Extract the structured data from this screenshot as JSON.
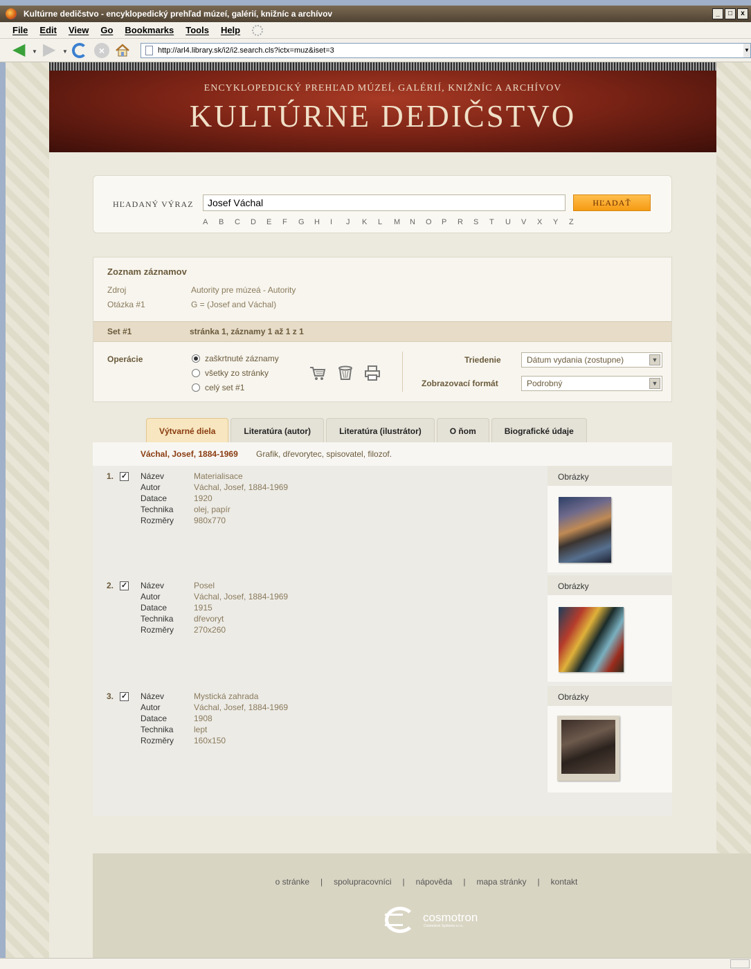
{
  "window": {
    "title": "Kultúrne dedičstvo - encyklopedický prehľad múzeí, galérií, knižníc a archívov",
    "buttons": {
      "minimize": "_",
      "maximize": "□",
      "close": "x"
    }
  },
  "menu": [
    "File",
    "Edit",
    "View",
    "Go",
    "Bookmarks",
    "Tools",
    "Help"
  ],
  "address": {
    "url": "http://arl4.library.sk/i2/i2.search.cls?ictx=muz&iset=3"
  },
  "banner": {
    "subtitle": "ENCYKLOPEDICKÝ PREHĽAD MÚZEÍ, GALÉRIÍ, KNIŽNÍC A ARCHÍVOV",
    "title": "KULTÚRNE DEDIČSTVO"
  },
  "search": {
    "label": "HĽADANÝ VÝRAZ",
    "value": "Josef Váchal",
    "button": "HĽADAŤ",
    "alphabet": [
      "A",
      "B",
      "C",
      "D",
      "E",
      "F",
      "G",
      "H",
      "I",
      "J",
      "K",
      "L",
      "M",
      "N",
      "O",
      "P",
      "R",
      "S",
      "T",
      "U",
      "V",
      "X",
      "Y",
      "Z"
    ]
  },
  "records": {
    "title": "Zoznam záznamov",
    "source_label": "Zdroj",
    "source_value": "Autority pre múzeá - Autority",
    "query_label": "Otázka #1",
    "query_value": "G = (Josef and Váchal)",
    "set_label": "Set #1",
    "set_info": "stránka 1, záznamy 1 až 1 z 1",
    "operations_label": "Operácie",
    "options": [
      "zaškrtnuté záznamy",
      "všetky zo stránky",
      "celý set #1"
    ],
    "selected_option": "zaškrtnuté záznamy",
    "sort_label": "Triedenie",
    "sort_value": "Dátum vydania (zostupne)",
    "format_label": "Zobrazovací formát",
    "format_value": "Podrobný"
  },
  "tabs": [
    {
      "label": "Výtvarné diela",
      "active": true
    },
    {
      "label": "Literatúra (autor)",
      "active": false
    },
    {
      "label": "Literatúra (ilustrátor)",
      "active": false
    },
    {
      "label": "O ňom",
      "active": false
    },
    {
      "label": "Biografické údaje",
      "active": false
    }
  ],
  "author": {
    "name": "Váchal, Josef, 1884-1969",
    "desc": "Grafik, dřevorytec, spisovatel, filozof."
  },
  "field_labels": {
    "nazev": "Název",
    "autor": "Autor",
    "datace": "Datace",
    "technika": "Technika",
    "rozmery": "Rozměry",
    "images": "Obrázky"
  },
  "items": [
    {
      "num": "1.",
      "checked": true,
      "nazev": "Materialisace",
      "autor": "Váchal, Josef, 1884-1969",
      "datace": "1920",
      "technika": "olej, papír",
      "rozmery": "980x770"
    },
    {
      "num": "2.",
      "checked": true,
      "nazev": "Posel",
      "autor": "Váchal, Josef, 1884-1969",
      "datace": "1915",
      "technika": "dřevoryt",
      "rozmery": "270x260"
    },
    {
      "num": "3.",
      "checked": true,
      "nazev": "Mystická zahrada",
      "autor": "Váchal, Josef, 1884-1969",
      "datace": "1908",
      "technika": "lept",
      "rozmery": "160x150"
    }
  ],
  "footer": {
    "links": [
      "o stránke",
      "spolupracovníci",
      "nápověda",
      "mapa stránky",
      "kontakt"
    ],
    "separator": "|",
    "logo_name": "cosmotron",
    "logo_tag": "Cosmotron Systems s.r.o."
  }
}
